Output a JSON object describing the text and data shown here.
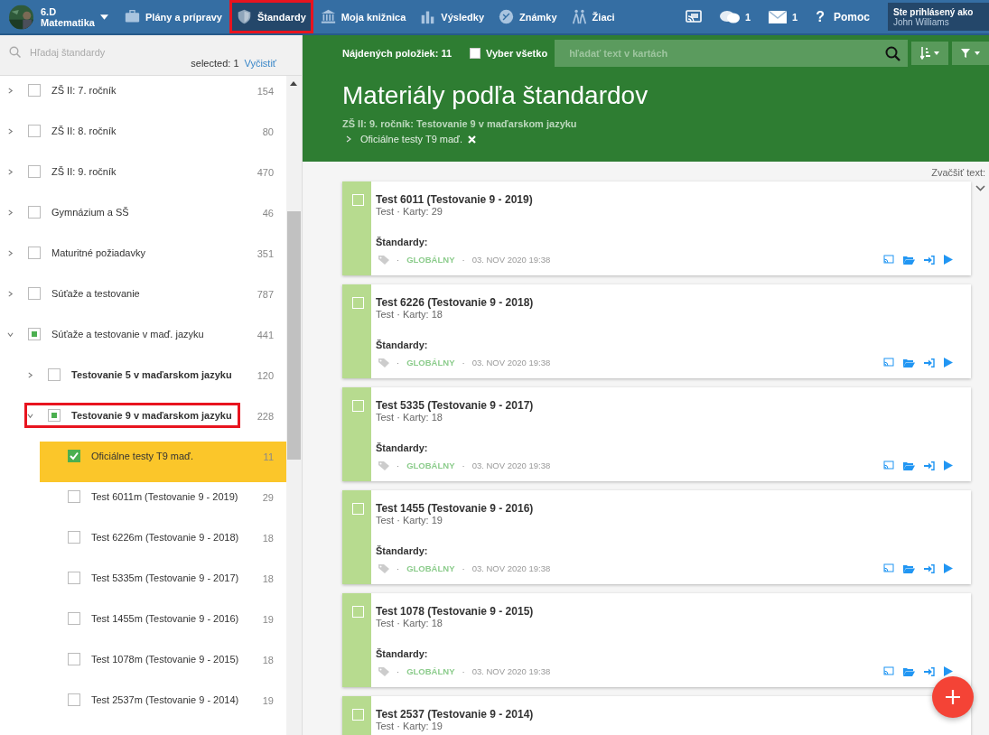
{
  "topbar": {
    "class_name": "6.D",
    "subject": "Matematika",
    "nav": [
      {
        "label": "Plány a prípravy",
        "selected": false,
        "highlighted": false
      },
      {
        "label": "Štandardy",
        "selected": true,
        "highlighted": true
      },
      {
        "label": "Moja knižnica",
        "selected": false,
        "highlighted": false
      },
      {
        "label": "Výsledky",
        "selected": false,
        "highlighted": false
      },
      {
        "label": "Známky",
        "selected": false,
        "highlighted": false
      },
      {
        "label": "Žiaci",
        "selected": false,
        "highlighted": false
      }
    ],
    "messages_count": "1",
    "mail_count": "1",
    "help_glyph": "?",
    "help_label": "Pomoc",
    "user_caption": "Ste prihlásený ako",
    "user_name": "John Williams"
  },
  "sidebar": {
    "search": {
      "placeholder": "Hľadaj štandardy"
    },
    "selected_info": "selected: 1",
    "clear_link": "Vyčistiť",
    "tree": [
      {
        "label": "ZŠ II: 7. ročník",
        "count": "154",
        "expanded": false,
        "checked": false,
        "partial": false,
        "selected": false,
        "highlighted": false
      },
      {
        "label": "ZŠ II: 8. ročník",
        "count": "80",
        "expanded": false,
        "checked": false,
        "partial": false,
        "selected": false,
        "highlighted": false
      },
      {
        "label": "ZŠ II: 9. ročník",
        "count": "470",
        "expanded": false,
        "checked": false,
        "partial": false,
        "selected": false,
        "highlighted": false
      },
      {
        "label": "Gymnázium a SŠ",
        "count": "46",
        "expanded": false,
        "checked": false,
        "partial": false,
        "selected": false,
        "highlighted": false
      },
      {
        "label": "Maturitné požiadavky",
        "count": "351",
        "expanded": false,
        "checked": false,
        "partial": false,
        "selected": false,
        "highlighted": false
      },
      {
        "label": "Súťaže a testovanie",
        "count": "787",
        "expanded": false,
        "checked": false,
        "partial": false,
        "selected": false,
        "highlighted": false
      },
      {
        "label": "Súťaže a testovanie v maď. jazyku",
        "count": "441",
        "expanded": true,
        "checked": false,
        "partial": true,
        "selected": false,
        "highlighted": false,
        "children": [
          {
            "label": "Testovanie 5 v maďarskom jazyku",
            "count": "120",
            "expanded": false,
            "checked": false,
            "partial": false,
            "selected": false,
            "highlighted": false
          },
          {
            "label": "Testovanie 9 v maďarskom jazyku",
            "count": "228",
            "expanded": true,
            "checked": false,
            "partial": true,
            "selected": false,
            "highlighted": true,
            "children": [
              {
                "label": "Oficiálne testy T9 maď.",
                "count": "11",
                "checked": true,
                "partial": false,
                "selected": true,
                "highlighted": false
              },
              {
                "label": "Test 6011m (Testovanie 9 - 2019)",
                "count": "29",
                "checked": false,
                "partial": false,
                "selected": false,
                "highlighted": false
              },
              {
                "label": "Test 6226m (Testovanie 9 - 2018)",
                "count": "18",
                "checked": false,
                "partial": false,
                "selected": false,
                "highlighted": false
              },
              {
                "label": "Test 5335m (Testovanie 9 - 2017)",
                "count": "18",
                "checked": false,
                "partial": false,
                "selected": false,
                "highlighted": false
              },
              {
                "label": "Test 1455m (Testovanie 9 - 2016)",
                "count": "19",
                "checked": false,
                "partial": false,
                "selected": false,
                "highlighted": false
              },
              {
                "label": "Test 1078m (Testovanie 9 - 2015)",
                "count": "18",
                "checked": false,
                "partial": false,
                "selected": false,
                "highlighted": false
              },
              {
                "label": "Test 2537m (Testovanie 9 - 2014)",
                "count": "19",
                "checked": false,
                "partial": false,
                "selected": false,
                "highlighted": false
              }
            ]
          }
        ]
      }
    ]
  },
  "main": {
    "found": "Nájdených položiek: 11",
    "select_all": {
      "label": "Vyber všetko",
      "checked": false
    },
    "search": {
      "placeholder": "hľadať text v kartách"
    },
    "title": "Materiály podľa štandardov",
    "breadcrumb": "ZŠ II: 9. ročník: Testovanie 9 v maďarskom jazyku",
    "filter_chip": "Oficiálne testy T9 maď.",
    "zoom_label": "Zvačšiť text:",
    "cards": [
      {
        "title": "Test 6011 (Testovanie 9 - 2019)",
        "meta": "Test · Karty: 29",
        "checked": false,
        "standards_label": "Štandardy:",
        "scope_prefix": "·",
        "scope": "GLOBÁLNY",
        "date_prefix": "·",
        "date": "03. NOV 2020 19:38"
      },
      {
        "title": "Test 6226 (Testovanie 9 - 2018)",
        "meta": "Test · Karty: 18",
        "checked": false,
        "standards_label": "Štandardy:",
        "scope_prefix": "·",
        "scope": "GLOBÁLNY",
        "date_prefix": "·",
        "date": "03. NOV 2020 19:38"
      },
      {
        "title": "Test 5335 (Testovanie 9 - 2017)",
        "meta": "Test · Karty: 18",
        "checked": false,
        "standards_label": "Štandardy:",
        "scope_prefix": "·",
        "scope": "GLOBÁLNY",
        "date_prefix": "·",
        "date": "03. NOV 2020 19:38"
      },
      {
        "title": "Test 1455 (Testovanie 9 - 2016)",
        "meta": "Test · Karty: 19",
        "checked": false,
        "standards_label": "Štandardy:",
        "scope_prefix": "·",
        "scope": "GLOBÁLNY",
        "date_prefix": "·",
        "date": "03. NOV 2020 19:38"
      },
      {
        "title": "Test 1078 (Testovanie 9 - 2015)",
        "meta": "Test · Karty: 18",
        "checked": false,
        "standards_label": "Štandardy:",
        "scope_prefix": "·",
        "scope": "GLOBÁLNY",
        "date_prefix": "·",
        "date": "03. NOV 2020 19:38"
      },
      {
        "title": "Test 2537 (Testovanie 9 - 2014)",
        "meta": "Test · Karty: 19",
        "checked": false
      }
    ]
  }
}
